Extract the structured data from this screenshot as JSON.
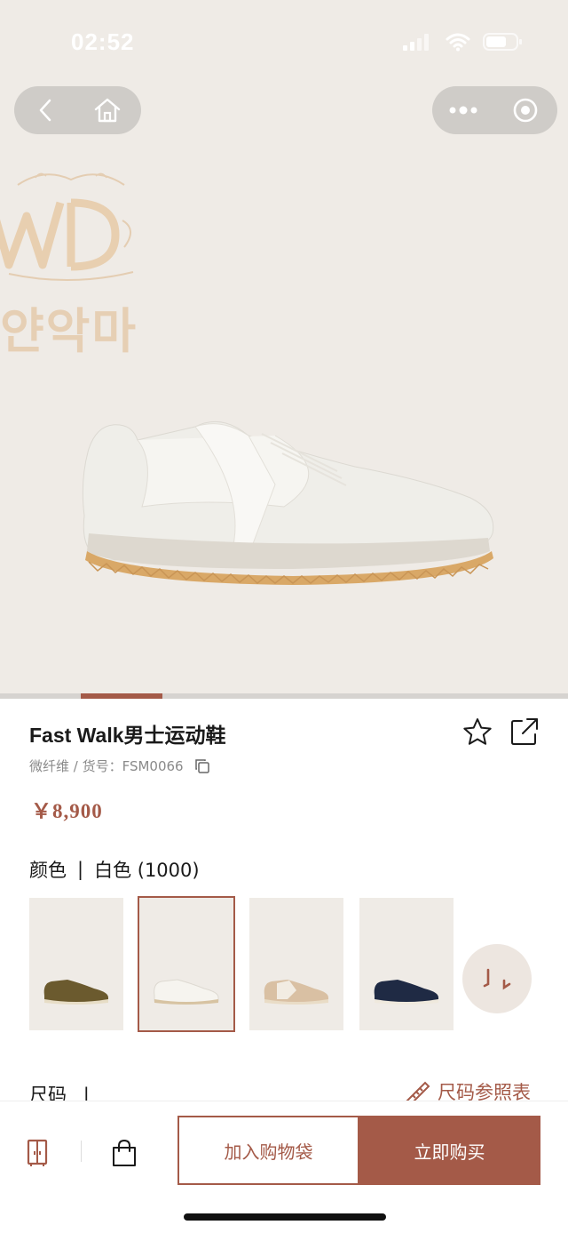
{
  "status_bar": {
    "time": "02:52"
  },
  "nav": {
    "back_icon": "chevron-left-icon",
    "home_icon": "home-icon",
    "more_icon": "more-dots-icon",
    "close_icon": "target-close-icon"
  },
  "hero": {
    "brand_korean": "얀악마",
    "image_progress": 0.14
  },
  "product": {
    "title": "Fast Walk男士运动鞋",
    "material": "微纤维 / 货号：FSM0066",
    "price": "￥8,900"
  },
  "color": {
    "label": "颜色",
    "selected": "白色 (1000)",
    "swatches": [
      {
        "name": "olive",
        "color": "#6b5a2e"
      },
      {
        "name": "white",
        "color": "#f2f0ea"
      },
      {
        "name": "beige",
        "color": "#d9c0a3"
      },
      {
        "name": "navy",
        "color": "#1f2a44"
      }
    ]
  },
  "size": {
    "label": "尺码",
    "chart_link": "尺码参照表"
  },
  "bottom_bar": {
    "add_to_bag": "加入购物袋",
    "buy_now": "立即购买"
  },
  "colors": {
    "accent": "#a45a48",
    "hero_bg": "#efebe6"
  }
}
